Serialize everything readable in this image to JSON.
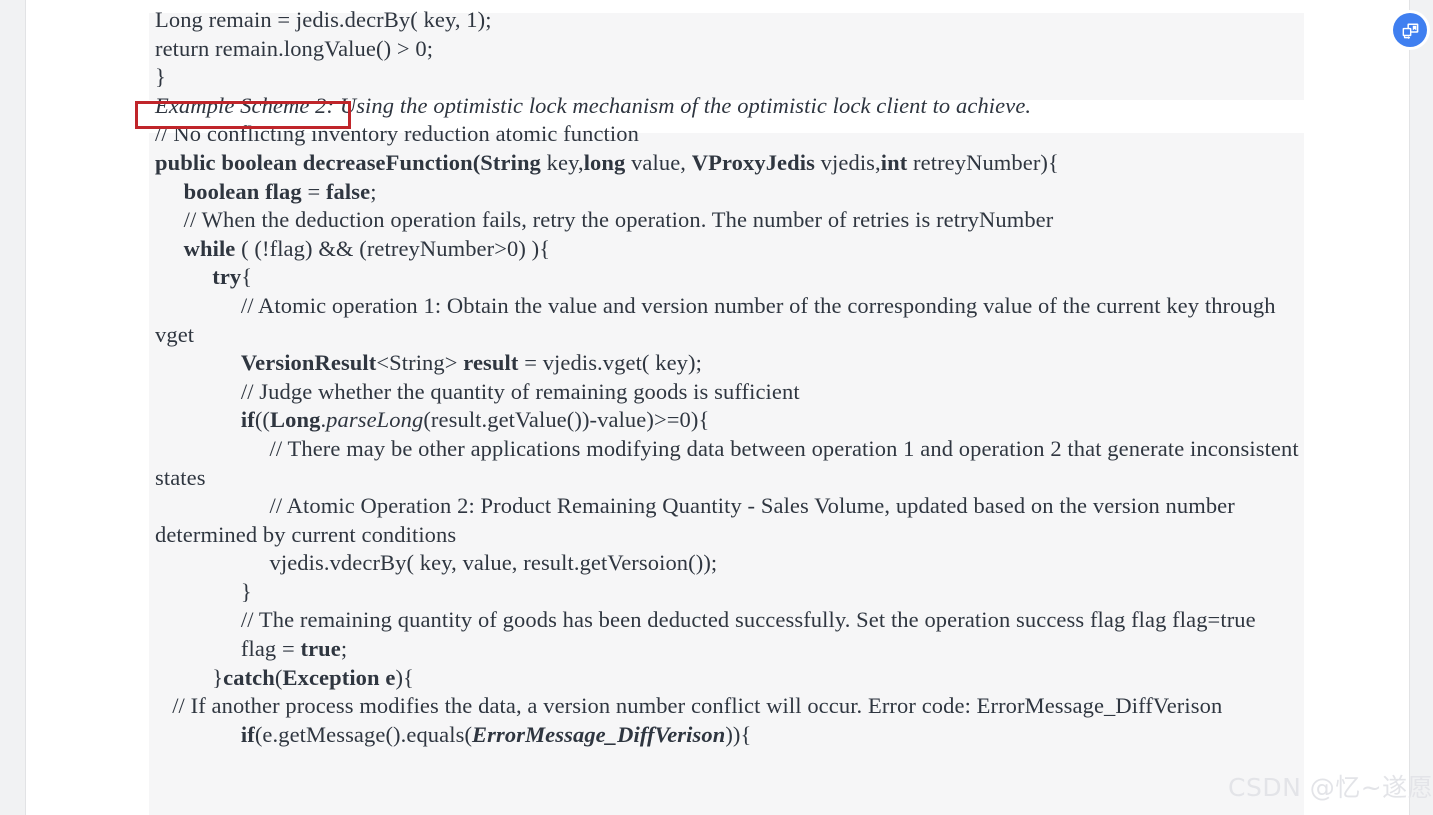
{
  "window": {
    "background_color": "#ffffff",
    "gutter_color": "#f1f2f3",
    "selection_color": "#f6f6f7"
  },
  "annotation": {
    "red_box_color": "#c0252a",
    "red_box_target": "Example Scheme 2:"
  },
  "fab": {
    "name": "save-image-button",
    "color": "#3f7ff0",
    "tooltip": ""
  },
  "watermark": {
    "text": "CSDN @忆~遂愿",
    "color": "#e3e4e8"
  },
  "document": {
    "text_color": "#2f3640",
    "lines": [
      {
        "id": "l01",
        "runs": [
          {
            "t": "Long remain = jedis.decrBy( key, 1);",
            "s": "n"
          }
        ]
      },
      {
        "id": "l02",
        "runs": [
          {
            "t": "return remain.longValue() > 0;",
            "s": "n"
          }
        ]
      },
      {
        "id": "l03",
        "runs": [
          {
            "t": "}",
            "s": "n"
          }
        ]
      },
      {
        "id": "l04",
        "runs": [
          {
            "t": "Example Scheme 2:",
            "s": "i"
          },
          {
            "t": " Using the optimistic lock mechanism of the optimistic lock client to achieve.",
            "s": "i"
          }
        ]
      },
      {
        "id": "l05",
        "runs": [
          {
            "t": "// No conflicting inventory reduction atomic function",
            "s": "n"
          }
        ]
      },
      {
        "id": "l06",
        "runs": [
          {
            "t": "public boolean decreaseFunction(",
            "s": "b"
          },
          {
            "t": "String",
            "s": "b"
          },
          {
            "t": " key,",
            "s": "n"
          },
          {
            "t": "long",
            "s": "b"
          },
          {
            "t": " value, ",
            "s": "n"
          },
          {
            "t": "VProxyJedis",
            "s": "b"
          },
          {
            "t": " vjedis,",
            "s": "n"
          },
          {
            "t": "int",
            "s": "b"
          },
          {
            "t": " retreyNumber){",
            "s": "n"
          }
        ]
      },
      {
        "id": "l07",
        "runs": [
          {
            "t": "     ",
            "s": "n"
          },
          {
            "t": "boolean flag",
            "s": "b"
          },
          {
            "t": " = ",
            "s": "n"
          },
          {
            "t": "false",
            "s": "b"
          },
          {
            "t": ";",
            "s": "n"
          }
        ]
      },
      {
        "id": "l08",
        "runs": [
          {
            "t": "     // When the deduction operation fails, retry the operation. The number of retries is retryNumber",
            "s": "n"
          }
        ]
      },
      {
        "id": "l09",
        "runs": [
          {
            "t": "     ",
            "s": "n"
          },
          {
            "t": "while",
            "s": "b"
          },
          {
            "t": " ( (!flag) && (retreyNumber>0) ){",
            "s": "n"
          }
        ]
      },
      {
        "id": "l10",
        "runs": [
          {
            "t": "          ",
            "s": "n"
          },
          {
            "t": "try",
            "s": "b"
          },
          {
            "t": "{",
            "s": "n"
          }
        ]
      },
      {
        "id": "l11",
        "runs": [
          {
            "t": "               // Atomic operation 1: Obtain the value and version number of the corresponding value of the current key through vget",
            "s": "n"
          }
        ]
      },
      {
        "id": "l12",
        "runs": [
          {
            "t": "               ",
            "s": "n"
          },
          {
            "t": "VersionResult",
            "s": "b"
          },
          {
            "t": "<String> ",
            "s": "n"
          },
          {
            "t": "result",
            "s": "b"
          },
          {
            "t": " = vjedis.vget( key);",
            "s": "n"
          }
        ]
      },
      {
        "id": "l13",
        "runs": [
          {
            "t": "               // Judge whether the quantity of remaining goods is sufficient",
            "s": "n"
          }
        ]
      },
      {
        "id": "l14",
        "runs": [
          {
            "t": "               ",
            "s": "n"
          },
          {
            "t": "if",
            "s": "b"
          },
          {
            "t": "((",
            "s": "n"
          },
          {
            "t": "Long",
            "s": "b"
          },
          {
            "t": ".",
            "s": "n"
          },
          {
            "t": "parseLong",
            "s": "i"
          },
          {
            "t": "(result.getValue())-value)>=0){",
            "s": "n"
          }
        ]
      },
      {
        "id": "l15",
        "runs": [
          {
            "t": "                    // There may be other applications modifying data between operation 1 and operation 2 that generate inconsistent states",
            "s": "n"
          }
        ]
      },
      {
        "id": "l16",
        "runs": [
          {
            "t": "                    // Atomic Operation 2: Product Remaining Quantity - Sales Volume, updated based on the version number determined by current conditions",
            "s": "n"
          }
        ]
      },
      {
        "id": "l17",
        "runs": [
          {
            "t": "                    vjedis.vdecrBy( key, value, result.getVersoion());",
            "s": "n"
          }
        ]
      },
      {
        "id": "l18",
        "runs": [
          {
            "t": "               }",
            "s": "n"
          }
        ]
      },
      {
        "id": "l19",
        "runs": [
          {
            "t": "               // The remaining quantity of goods has been deducted successfully. Set the operation success flag flag flag=true",
            "s": "n"
          }
        ]
      },
      {
        "id": "l20",
        "runs": [
          {
            "t": "               flag = ",
            "s": "n"
          },
          {
            "t": "true",
            "s": "b"
          },
          {
            "t": ";",
            "s": "n"
          }
        ]
      },
      {
        "id": "l21",
        "runs": [
          {
            "t": "          }",
            "s": "n"
          },
          {
            "t": "catch",
            "s": "b"
          },
          {
            "t": "(",
            "s": "n"
          },
          {
            "t": "Exception e",
            "s": "b"
          },
          {
            "t": "){",
            "s": "n"
          }
        ]
      },
      {
        "id": "l22",
        "runs": [
          {
            "t": "   // If another process modifies the data, a version number conflict will occur. Error code: ErrorMessage_DiffVerison",
            "s": "n"
          }
        ]
      },
      {
        "id": "l23",
        "runs": [
          {
            "t": "               ",
            "s": "n"
          },
          {
            "t": "if",
            "s": "b"
          },
          {
            "t": "(e.getMessage().equals(",
            "s": "n"
          },
          {
            "t": "ErrorMessage_DiffVerison",
            "s": "bi"
          },
          {
            "t": ")){",
            "s": "n"
          }
        ]
      }
    ]
  }
}
